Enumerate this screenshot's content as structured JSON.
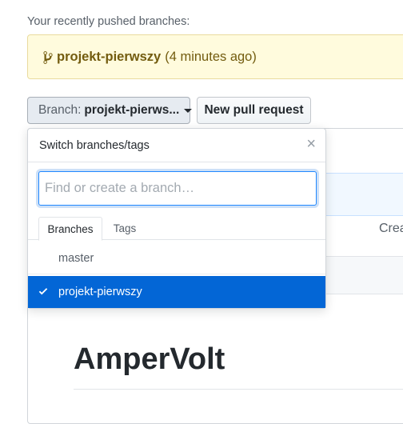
{
  "recent": {
    "label": "Your recently pushed branches:",
    "branch": "projekt-pierwszy",
    "time": "(4 minutes ago)"
  },
  "toolbar": {
    "branch_prefix": "Branch:",
    "branch_current": "projekt-pierws...",
    "new_pr_label": "New pull request"
  },
  "dropdown": {
    "title": "Switch branches/tags",
    "close_glyph": "×",
    "filter_placeholder": "Find or create a branch…",
    "filter_value": "",
    "tabs": [
      "Branches",
      "Tags"
    ],
    "items": [
      {
        "label": "master",
        "selected": false
      },
      {
        "label": "projekt-pierwszy",
        "selected": true
      }
    ]
  },
  "background": {
    "create_text": "Crea",
    "heading": "AmperVolt"
  },
  "colors": {
    "accent": "#0366d6",
    "flash_bg": "#fffbdd",
    "flash_text": "#735c0f"
  },
  "icons": {
    "branch": "git-branch-icon",
    "check": "check-icon",
    "close": "close-icon",
    "caret": "caret-down-icon"
  }
}
